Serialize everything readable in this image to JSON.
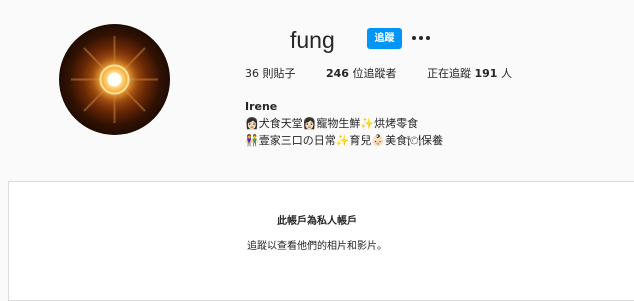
{
  "profile": {
    "username": "fung",
    "follow_label": "追蹤",
    "more_icon": "more-horizontal-icon",
    "avatar_alt": "candle light photo"
  },
  "stats": {
    "posts": "36 則貼子",
    "followers_label": "位追蹤者",
    "followers_count": "246",
    "following_label": "正在追蹤",
    "following_count": "191",
    "following_unit": "人"
  },
  "bio": {
    "name": "Irene",
    "line1": "👩🏻犬食天堂👩🏻寵物生鮮✨烘烤零食",
    "line2": "👫壹家三口の日常✨育兒👶🏻美食🍽保養"
  },
  "private": {
    "title": "此帳戶為私人帳戶",
    "subtitle": "追蹤以查看他們的相片和影片。"
  },
  "colors": {
    "background": "#fafafa",
    "accent": "#0095f6",
    "text": "#262626",
    "border": "#dbdbdb"
  }
}
